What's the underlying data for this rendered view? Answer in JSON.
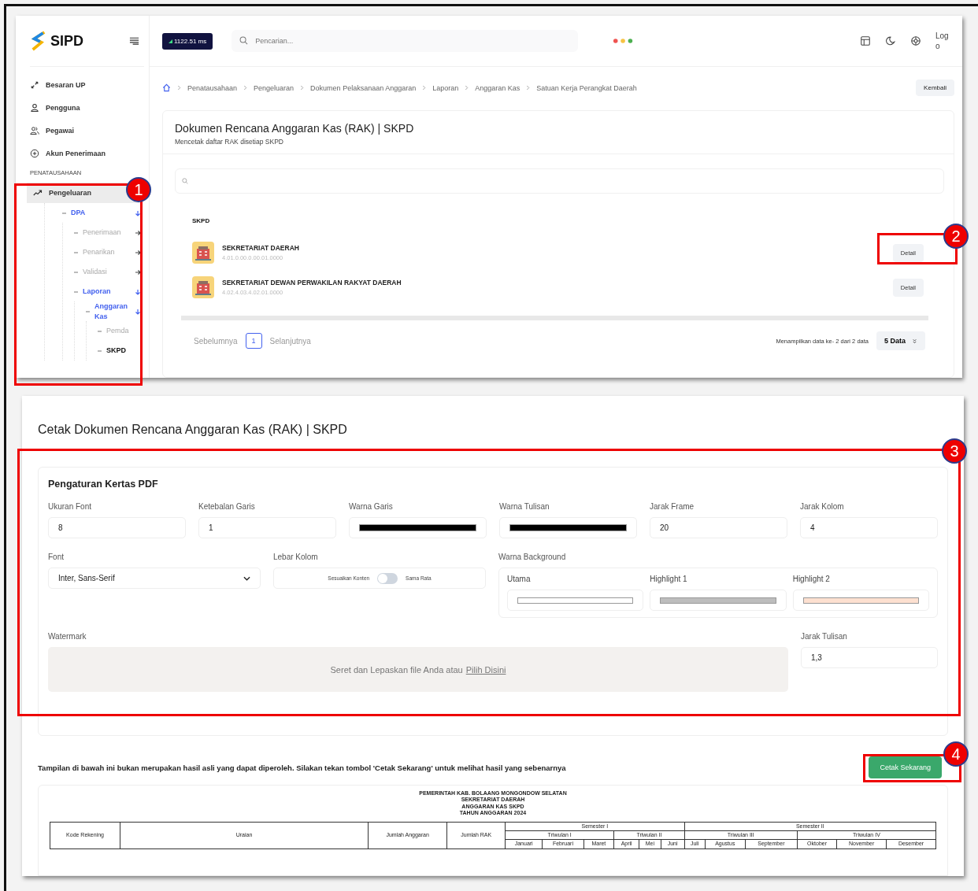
{
  "top_screen": {
    "logo": "SIPD",
    "ping": "1122.51 ms",
    "search_placeholder": "Pencarian...",
    "avatar_alt": "Logo",
    "sidebar": {
      "items": [
        {
          "label": "Besaran UP",
          "kind": "expand"
        },
        {
          "label": "Pengguna",
          "kind": "user"
        },
        {
          "label": "Pegawai",
          "kind": "users"
        },
        {
          "label": "Akun Penerimaan",
          "kind": "plus"
        }
      ],
      "section": "PENATAUSAHAAN",
      "group": {
        "label": "Pengeluaran",
        "selected": true
      },
      "tree": [
        {
          "label": "DPA",
          "active": true,
          "expanded": true,
          "children": [
            {
              "label": "Penerimaan",
              "active": false,
              "expanded": false
            },
            {
              "label": "Penarikan",
              "active": false,
              "expanded": false
            },
            {
              "label": "Validasi",
              "active": false,
              "expanded": false
            },
            {
              "label": "Laporan",
              "active": true,
              "expanded": true,
              "children": [
                {
                  "label": "Anggaran Kas",
                  "active": true,
                  "expanded": true,
                  "children": [
                    {
                      "label": "Pemda",
                      "active": false,
                      "selected": false
                    },
                    {
                      "label": "SKPD",
                      "active": false,
                      "selected": true
                    }
                  ]
                }
              ]
            }
          ]
        }
      ]
    },
    "breadcrumb": [
      "Penatausahaan",
      "Pengeluaran",
      "Dokumen Pelaksanaan Anggaran",
      "Laporan",
      "Anggaran Kas",
      "Satuan Kerja Perangkat Daerah"
    ],
    "back_button": "Kembali",
    "card": {
      "title": "Dokumen Rencana Anggaran Kas (RAK) | SKPD",
      "subtitle": "Mencetak daftar RAK disetiap SKPD",
      "column": "SKPD",
      "rows": [
        {
          "name": "SEKRETARIAT DAERAH",
          "code": "4.01.0.00.0.00.01.0000",
          "action": "Detail"
        },
        {
          "name": "SEKRETARIAT DEWAN PERWAKILAN RAKYAT DAERAH",
          "code": "4.02.4.03.4.02.01.0000",
          "action": "Detail"
        }
      ],
      "pagination": {
        "prev": "Sebelumnya",
        "page": "1",
        "next": "Selanjutnya",
        "info": "Menampilkan data ke- 2 dari 2 data",
        "per_page": "5 Data"
      }
    }
  },
  "bottom_screen": {
    "title": "Cetak Dokumen Rencana Anggaran Kas (RAK) | SKPD",
    "settings": {
      "title": "Pengaturan Kertas PDF",
      "fields": [
        {
          "label": "Ukuran Font",
          "kind": "text",
          "value": "8"
        },
        {
          "label": "Ketebalan Garis",
          "kind": "text",
          "value": "1"
        },
        {
          "label": "Warna Garis",
          "kind": "color",
          "color": "#000000"
        },
        {
          "label": "Warna Tulisan",
          "kind": "color",
          "color": "#000000"
        },
        {
          "label": "Jarak Frame",
          "kind": "text",
          "value": "20"
        },
        {
          "label": "Jarak Kolom",
          "kind": "text",
          "value": "4"
        }
      ],
      "font": {
        "label": "Font",
        "value": "Inter, Sans-Serif"
      },
      "column_width": {
        "label": "Lebar Kolom",
        "left": "Sesuaikan Konten",
        "right": "Sama Rata",
        "on": false
      },
      "background": {
        "label": "Warna Background",
        "swatches": [
          {
            "label": "Utama",
            "color": "#ffffff"
          },
          {
            "label": "Highlight 1",
            "color": "#bdbdbd"
          },
          {
            "label": "Highlight 2",
            "color": "#fde0d0"
          }
        ]
      },
      "watermark": {
        "label": "Watermark",
        "text": "Seret dan Lepaskan file Anda atau",
        "link": "Pilih Disini"
      },
      "text_spacing": {
        "label": "Jarak Tulisan",
        "value": "1,3"
      }
    },
    "notice": "Tampilan di bawah ini bukan merupakan hasil asli yang dapat diperoleh. Silakan tekan tombol 'Cetak Sekarang' untuk melihat hasil yang sebenarnya",
    "print_button": "Cetak Sekarang",
    "preview": {
      "heading": [
        "PEMERINTAH KAB. BOLAANG MONGONDOW SELATAN",
        "SEKRETARIAT DAERAH",
        "ANGGARAN KAS SKPD",
        "TAHUN ANGGARAN 2024"
      ],
      "fixed_columns": [
        "Kode Rekening",
        "Uraian",
        "Jumlah Anggaran",
        "Jumlah RAK"
      ],
      "semesters": [
        {
          "label": "Semester I",
          "quarters": [
            {
              "label": "Triwulan I",
              "months": [
                "Januari",
                "Februari",
                "Maret"
              ]
            },
            {
              "label": "Triwulan II",
              "months": [
                "April",
                "Mei",
                "Juni"
              ]
            }
          ]
        },
        {
          "label": "Semester II",
          "quarters": [
            {
              "label": "Triwulan III",
              "months": [
                "Juli",
                "Agustus",
                "September"
              ]
            },
            {
              "label": "Triwulan IV",
              "months": [
                "Oktober",
                "November",
                "Desember"
              ]
            }
          ]
        }
      ]
    }
  },
  "callouts": [
    "1",
    "2",
    "3",
    "4"
  ]
}
